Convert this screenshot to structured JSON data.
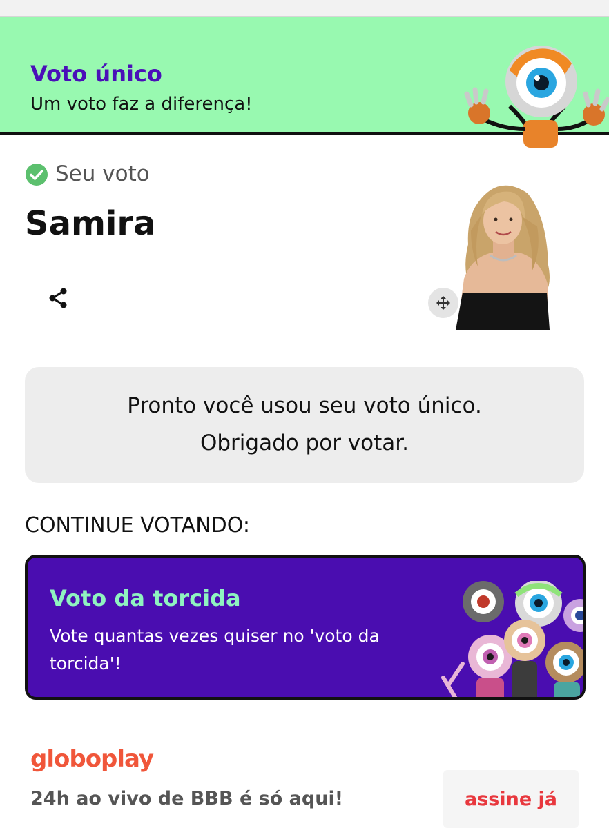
{
  "banner": {
    "title": "Voto único",
    "subtitle": "Um voto faz a diferença!",
    "mascot_icon": "bbb-eye-mascot-icon",
    "bg_color": "#98f9b0",
    "title_color": "#4a10b8"
  },
  "vote": {
    "status_label": "Seu voto",
    "status_icon": "check-circle-icon",
    "candidate_name": "Samira",
    "share_icon": "share-icon",
    "move_icon": "move-arrows-icon"
  },
  "confirmation": {
    "line1": "Pronto você usou seu voto único.",
    "line2": "Obrigado por votar."
  },
  "continue": {
    "label": "CONTINUE VOTANDO:"
  },
  "torcida_card": {
    "title": "Voto da torcida",
    "description": "Vote quantas vezes quiser no 'voto da torcida'!",
    "bg_color": "#4a0db0",
    "title_color": "#8ff3c0"
  },
  "footer": {
    "brand": "globoplay",
    "text": "24h ao vivo de BBB é só aqui!",
    "cta": "assine já",
    "cta_color": "#e8383e"
  }
}
